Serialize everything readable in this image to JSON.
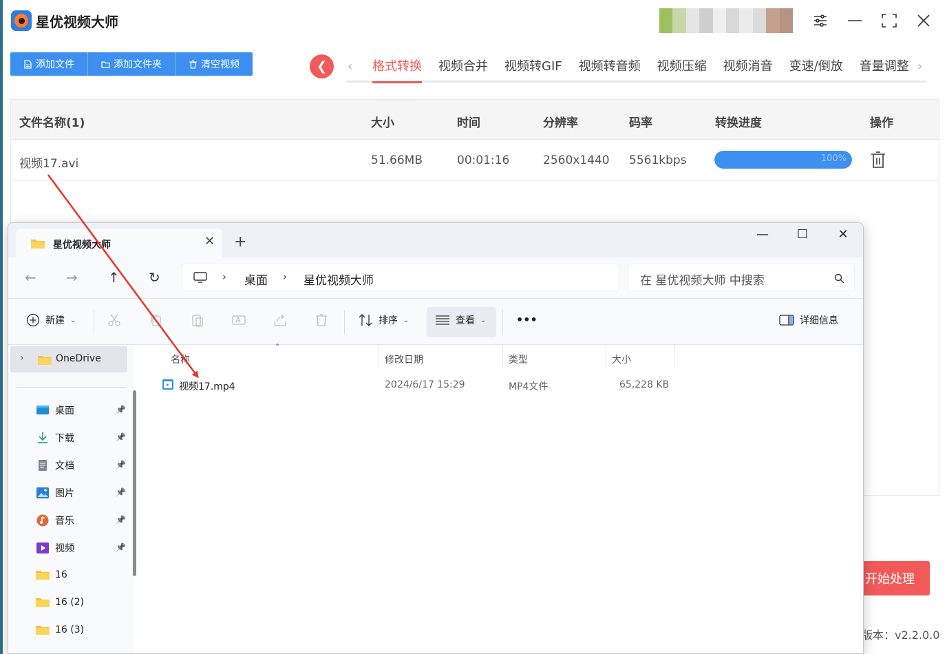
{
  "app": {
    "title": "星优视频大师",
    "toolbar": {
      "add_file": "添加文件",
      "add_folder": "添加文件夹",
      "clear": "清空视频"
    },
    "tabs": [
      "格式转换",
      "视频合并",
      "视频转GIF",
      "视频转音频",
      "视频压缩",
      "视频消音",
      "变速/倒放",
      "音量调整"
    ],
    "active_tab": "格式转换",
    "table": {
      "headers": {
        "name": "文件名称(1)",
        "size": "大小",
        "time": "时间",
        "resolution": "分辨率",
        "bitrate": "码率",
        "progress": "转换进度",
        "action": "操作"
      },
      "rows": [
        {
          "name": "视频17.avi",
          "size": "51.66MB",
          "time": "00:01:16",
          "resolution": "2560x1440",
          "bitrate": "5561kbps",
          "progress_label": "100%",
          "progress": 1.0
        }
      ]
    },
    "start_button": "开始处理",
    "version": "版本：v2.2.0.0"
  },
  "explorer": {
    "tab_title": "星优视频大师",
    "breadcrumb": [
      "桌面",
      "星优视频大师"
    ],
    "search_placeholder": "在 星优视频大师 中搜索",
    "commands": {
      "new": "新建",
      "sort": "排序",
      "view": "查看",
      "more": "•••",
      "details": "详细信息"
    },
    "sidebar": {
      "onedrive": "OneDrive",
      "items": [
        {
          "label": "桌面",
          "icon": "desktop-icon",
          "pinned": true
        },
        {
          "label": "下载",
          "icon": "download-icon",
          "pinned": true
        },
        {
          "label": "文档",
          "icon": "document-icon",
          "pinned": true
        },
        {
          "label": "图片",
          "icon": "picture-icon",
          "pinned": true
        },
        {
          "label": "音乐",
          "icon": "music-icon",
          "pinned": true
        },
        {
          "label": "视频",
          "icon": "video-icon",
          "pinned": true
        },
        {
          "label": "16",
          "icon": "folder-icon",
          "pinned": false
        },
        {
          "label": "16 (2)",
          "icon": "folder-icon",
          "pinned": false
        },
        {
          "label": "16 (3)",
          "icon": "folder-icon",
          "pinned": false
        }
      ]
    },
    "columns": {
      "name": "名称",
      "modified": "修改日期",
      "type": "类型",
      "size": "大小"
    },
    "files": [
      {
        "name": "视频17.mp4",
        "modified": "2024/6/17 15:29",
        "type": "MP4文件",
        "size": "65,228 KB"
      }
    ]
  },
  "colors": {
    "accent_blue": "#3d8ff0",
    "accent_red": "#f25a5a",
    "arrow_red": "#e8322a"
  }
}
